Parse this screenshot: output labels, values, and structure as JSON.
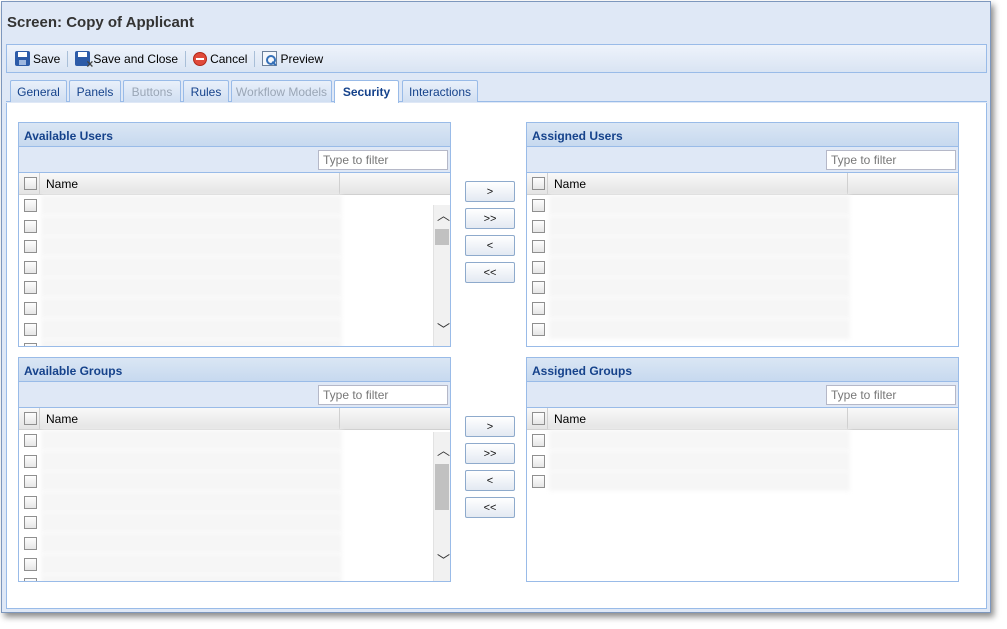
{
  "window": {
    "title": "Screen: Copy of Applicant"
  },
  "toolbar": {
    "save_label": "Save",
    "save_close_label": "Save and Close",
    "cancel_label": "Cancel",
    "preview_label": "Preview"
  },
  "tabs": [
    {
      "label": "General",
      "state": "enabled"
    },
    {
      "label": "Panels",
      "state": "enabled"
    },
    {
      "label": "Buttons",
      "state": "disabled"
    },
    {
      "label": "Rules",
      "state": "enabled"
    },
    {
      "label": "Workflow Models",
      "state": "disabled"
    },
    {
      "label": "Security",
      "state": "active"
    },
    {
      "label": "Interactions",
      "state": "enabled"
    }
  ],
  "available_users": {
    "title": "Available Users",
    "filter_placeholder": "Type to filter",
    "column_name": "Name",
    "rows": [
      "",
      "",
      "",
      "",
      "",
      "",
      "",
      ""
    ]
  },
  "assigned_users": {
    "title": "Assigned Users",
    "filter_placeholder": "Type to filter",
    "column_name": "Name",
    "rows": [
      "",
      "",
      "",
      "",
      "",
      "",
      ""
    ]
  },
  "available_groups": {
    "title": "Available Groups",
    "filter_placeholder": "Type to filter",
    "column_name": "Name",
    "rows": [
      "",
      "",
      "",
      "",
      "",
      "",
      "",
      ""
    ]
  },
  "assigned_groups": {
    "title": "Assigned Groups",
    "filter_placeholder": "Type to filter",
    "column_name": "Name",
    "rows": [
      "",
      "",
      ""
    ]
  },
  "move_buttons": {
    "users": [
      ">",
      ">>",
      "<",
      "<<"
    ],
    "groups": [
      ">",
      ">>",
      "<",
      "<<"
    ]
  },
  "colors": {
    "header_text": "#15428b",
    "panel_border": "#99bbe8",
    "toolbar_bg": "#dfe8f6"
  },
  "icons": [
    "save-icon",
    "save-and-close-icon",
    "cancel-icon",
    "preview-icon",
    "scroll-up-icon",
    "scroll-down-icon"
  ]
}
